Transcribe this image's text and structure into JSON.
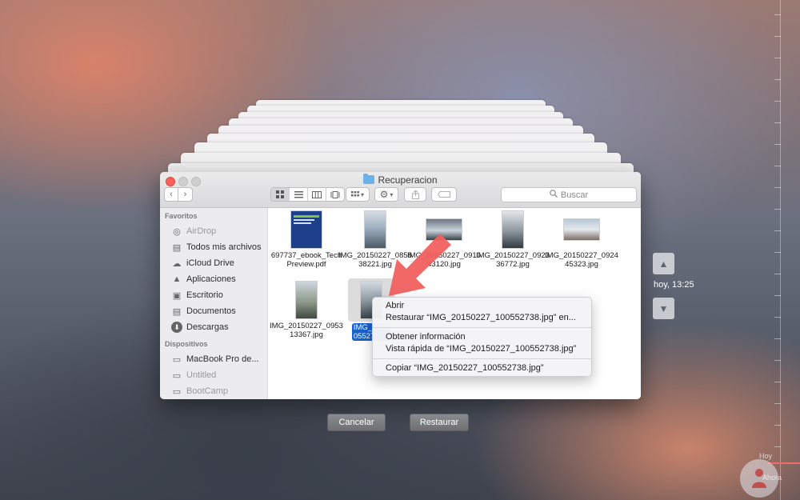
{
  "window": {
    "title": "Recuperacion",
    "search_placeholder": "Buscar"
  },
  "sidebar": {
    "favorites_header": "Favoritos",
    "favorites": [
      {
        "label": "AirDrop",
        "icon": "airdrop-icon",
        "dim": true
      },
      {
        "label": "Todos mis archivos",
        "icon": "all-files-icon",
        "dim": false
      },
      {
        "label": "iCloud Drive",
        "icon": "cloud-icon",
        "dim": false
      },
      {
        "label": "Aplicaciones",
        "icon": "applications-icon",
        "dim": false
      },
      {
        "label": "Escritorio",
        "icon": "desktop-icon",
        "dim": false
      },
      {
        "label": "Documentos",
        "icon": "documents-icon",
        "dim": false
      },
      {
        "label": "Descargas",
        "icon": "downloads-icon",
        "dim": false
      }
    ],
    "devices_header": "Dispositivos",
    "devices": [
      {
        "label": "MacBook Pro de...",
        "icon": "laptop-icon",
        "dim": false
      },
      {
        "label": "Untitled",
        "icon": "disk-icon",
        "dim": true
      },
      {
        "label": "BootCamp",
        "icon": "disk-icon",
        "dim": true
      }
    ]
  },
  "files": [
    {
      "label": "697737_ebook_TechPreview.pdf",
      "type": "pdf"
    },
    {
      "label": "IMG_20150227_085838221.jpg",
      "type": "portrait"
    },
    {
      "label": "IMG_20150227_091043120.jpg",
      "type": "landscape"
    },
    {
      "label": "IMG_20150227_092336772.jpg",
      "type": "portrait"
    },
    {
      "label": "IMG_20150227_092445323.jpg",
      "type": "landscape"
    },
    {
      "label": "IMG_20150227_095313367.jpg",
      "type": "portrait"
    },
    {
      "label": "IMG_20150227_100552738.jpg",
      "type": "portrait",
      "selected": true,
      "visible_label": "IMG_2015\n05527"
    }
  ],
  "context_menu": {
    "open": "Abrir",
    "restore": "Restaurar “IMG_20150227_100552738.jpg” en...",
    "get_info": "Obtener información",
    "quick_look": "Vista rápida de “IMG_20150227_100552738.jpg”",
    "copy": "Copiar “IMG_20150227_100552738.jpg”"
  },
  "buttons": {
    "cancel": "Cancelar",
    "restore": "Restaurar"
  },
  "timemachine": {
    "timestamp": "hoy, 13:25",
    "timeline_today": "Hoy",
    "timeline_now": "Ahora"
  },
  "colors": {
    "selection": "#1961d1",
    "close_button": "#fc605c",
    "arrow": "#f0605e"
  }
}
